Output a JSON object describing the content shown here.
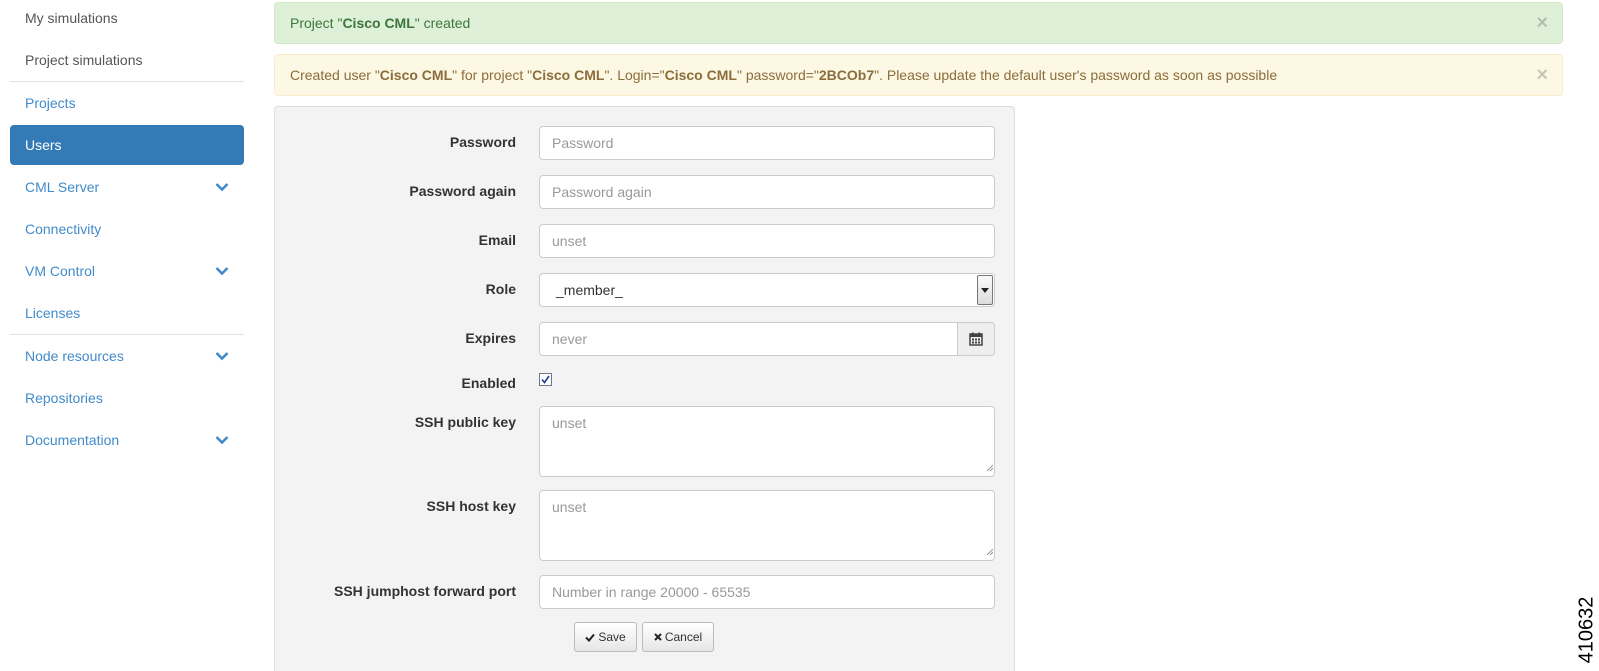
{
  "sidebar": {
    "items": [
      {
        "label": "My simulations"
      },
      {
        "label": "Project simulations"
      },
      {
        "label": "Projects"
      },
      {
        "label": "Users"
      },
      {
        "label": "CML Server"
      },
      {
        "label": "Connectivity"
      },
      {
        "label": "VM Control"
      },
      {
        "label": "Licenses"
      },
      {
        "label": "Node resources"
      },
      {
        "label": "Repositories"
      },
      {
        "label": "Documentation"
      }
    ],
    "active": "Users",
    "active_color": "#337ab7",
    "link_color": "#428bca"
  },
  "alerts": {
    "success": {
      "p1": "Project \"",
      "name": "Cisco CML",
      "p2": "\" created",
      "close": "×",
      "color": "#dff0d8"
    },
    "warning": {
      "p1": "Created user \"",
      "user": "Cisco CML",
      "p2": "\" for project \"",
      "project": "Cisco CML",
      "p3": "\". Login=\"",
      "login": "Cisco CML",
      "p4": "\" password=\"",
      "password": "2BCOb7",
      "p5": "\". Please update the default user's password as soon as possible",
      "close": "×",
      "color": "#fcf8e3"
    }
  },
  "form": {
    "password": {
      "label": "Password",
      "placeholder": "Password"
    },
    "password_again": {
      "label": "Password again",
      "placeholder": "Password again"
    },
    "email": {
      "label": "Email",
      "placeholder": "unset"
    },
    "role": {
      "label": "Role",
      "value": "_member_"
    },
    "expires": {
      "label": "Expires",
      "placeholder": "never",
      "icon": "calendar-icon"
    },
    "enabled": {
      "label": "Enabled",
      "checked": true
    },
    "ssh_public_key": {
      "label": "SSH public key",
      "placeholder": "unset"
    },
    "ssh_host_key": {
      "label": "SSH host key",
      "placeholder": "unset"
    },
    "ssh_jumphost_port": {
      "label": "SSH jumphost forward port",
      "placeholder": "Number in range 20000 - 65535"
    },
    "save_label": "Save",
    "cancel_label": "Cancel"
  },
  "figure_id": "410632"
}
